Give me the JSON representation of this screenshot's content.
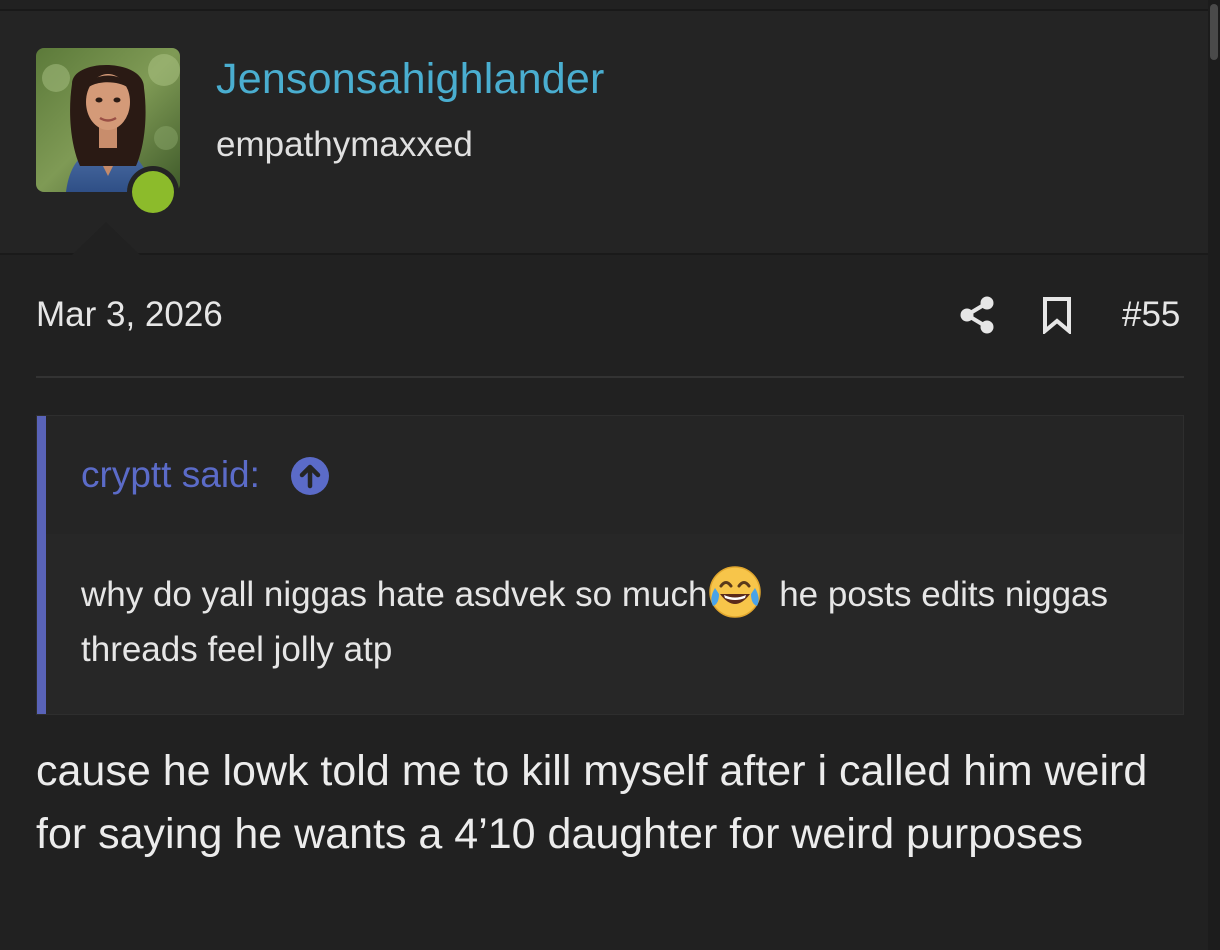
{
  "user": {
    "name": "Jensonsahighlander",
    "title": "empathymaxxed",
    "online": true
  },
  "post": {
    "date": "Mar 3, 2026",
    "number": "#55",
    "actions": {
      "share_icon": "share-icon",
      "bookmark_icon": "bookmark-icon"
    }
  },
  "quote": {
    "author_line": "cryptt said:",
    "jump_icon": "arrow-up-circle-icon",
    "body_before_emoji": "why do yall niggas hate asdvek so much",
    "emoji": "face-with-tears-of-joy",
    "body_after_emoji": " he posts edits niggas threads feel jolly atp"
  },
  "reply": {
    "text": "cause he lowk told me to kill myself after i called him weird for saying he wants a 4’10 daughter for weird purposes"
  },
  "colors": {
    "background": "#212121",
    "username": "#4aaed0",
    "quote_accent": "#5963b8",
    "online": "#8cbb2b"
  }
}
